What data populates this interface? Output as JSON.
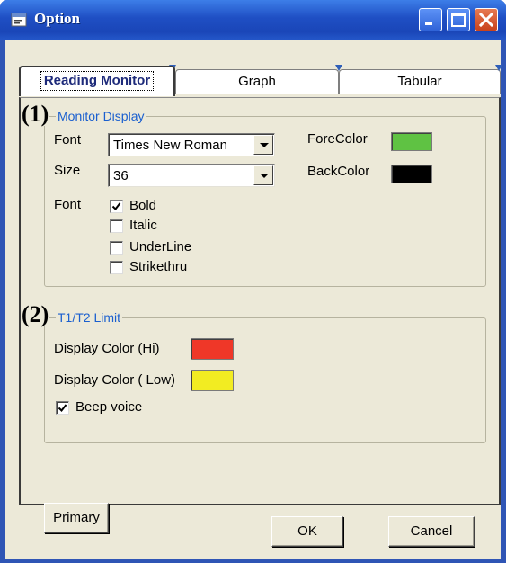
{
  "window": {
    "title": "Option"
  },
  "tabs": [
    {
      "label": "Reading Monitor",
      "active": true
    },
    {
      "label": "Graph",
      "active": false
    },
    {
      "label": "Tabular",
      "active": false
    }
  ],
  "monitor_display": {
    "number": "(1)",
    "legend": "Monitor Display",
    "font_label": "Font",
    "font_value": "Times New Roman",
    "size_label": "Size",
    "size_value": "36",
    "fore_color_label": "ForeColor",
    "fore_color": "#5fc243",
    "back_color_label": "BackColor",
    "back_color": "#000000",
    "style_label": "Font",
    "styles": [
      {
        "label": "Bold",
        "checked": true
      },
      {
        "label": "Italic",
        "checked": false
      },
      {
        "label": "UnderLine",
        "checked": false
      },
      {
        "label": "Strikethru",
        "checked": false
      }
    ]
  },
  "limit": {
    "number": "(2)",
    "legend": "T1/T2 Limit",
    "hi_label": "Display Color (Hi)",
    "hi_color": "#ef3728",
    "low_label": "Display Color ( Low)",
    "low_color": "#f2ec22",
    "beep_label": "Beep voice",
    "beep_checked": true
  },
  "buttons": {
    "primary": "Primary",
    "ok": "OK",
    "cancel": "Cancel"
  }
}
